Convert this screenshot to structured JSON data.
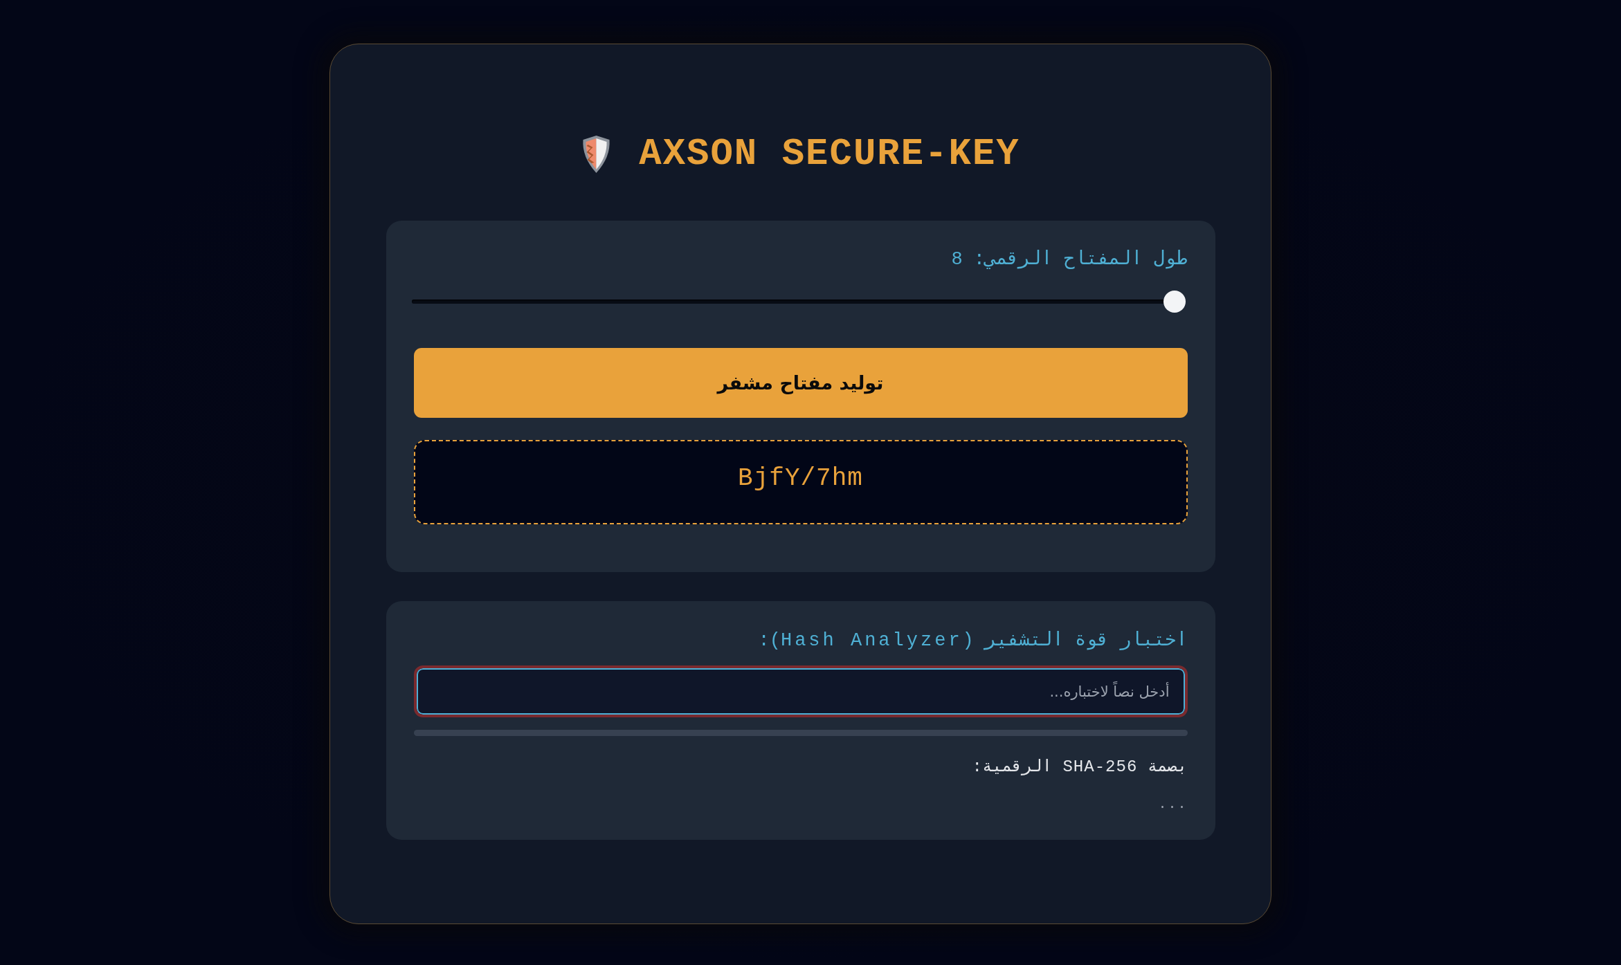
{
  "header": {
    "title": "AXSON SECURE-KEY"
  },
  "generator": {
    "length_label": "طول المفتاح الرقمي: 8",
    "length_slider": {
      "level": 0
    },
    "generate_button": "توليد مفتاح مشفر",
    "generated_key": "BjfY/7hm"
  },
  "analyzer": {
    "label": "اختبار قوة التشفير (Hash Analyzer):",
    "input": {
      "placeholder": "أدخل نصاً لاختباره..."
    },
    "strength_meter": {
      "level": 0
    },
    "hash_label": "بصمة SHA-256 الرقمية:",
    "hash_value": "..."
  }
}
